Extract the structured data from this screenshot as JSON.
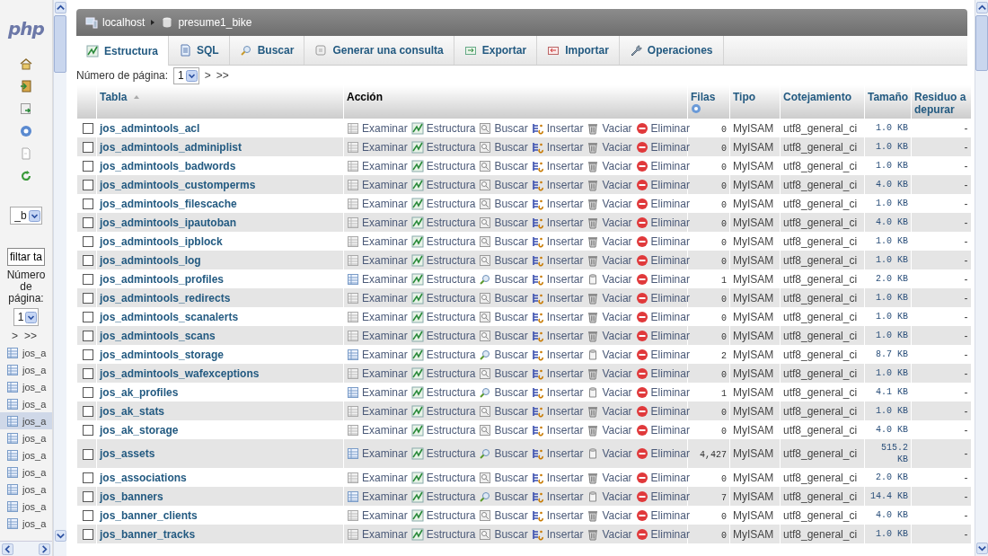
{
  "sidebar": {
    "logo": "php",
    "database_select": "_b",
    "filter": "filtar ta",
    "page_label": "Número de página:",
    "page_select": "1",
    "pager": [
      ">",
      ">>"
    ],
    "items": [
      {
        "label": "jos_a",
        "selected": false
      },
      {
        "label": "jos_a",
        "selected": false
      },
      {
        "label": "jos_a",
        "selected": false
      },
      {
        "label": "jos_a",
        "selected": false
      },
      {
        "label": "jos_a",
        "selected": true
      },
      {
        "label": "jos_a",
        "selected": false
      },
      {
        "label": "jos_a",
        "selected": false
      },
      {
        "label": "jos_a",
        "selected": false
      },
      {
        "label": "jos_a",
        "selected": false
      },
      {
        "label": "jos_a",
        "selected": false
      },
      {
        "label": "jos_a",
        "selected": false
      }
    ]
  },
  "breadcrumb": [
    {
      "kind": "server",
      "label": "localhost"
    },
    {
      "kind": "database",
      "label": "presume1_bike"
    }
  ],
  "tabs": [
    {
      "kind": "structure",
      "label": "Estructura",
      "selected": true
    },
    {
      "kind": "sql",
      "label": "SQL",
      "selected": false
    },
    {
      "kind": "search",
      "label": "Buscar",
      "selected": false
    },
    {
      "kind": "query",
      "label": "Generar una consulta",
      "selected": false
    },
    {
      "kind": "export",
      "label": "Exportar",
      "selected": false
    },
    {
      "kind": "import",
      "label": "Importar",
      "selected": false
    },
    {
      "kind": "operations",
      "label": "Operaciones",
      "selected": false
    }
  ],
  "pagination": {
    "label": "Número de página:",
    "value": "1",
    "next": ">",
    "last": ">>"
  },
  "table": {
    "columns": [
      "Tabla",
      "Acción",
      "Filas",
      "Tipo",
      "Cotejamiento",
      "Tamaño",
      "Residuo a depurar"
    ],
    "rows": [
      {
        "name": "jos_admintools_acl",
        "checked": false,
        "empty": true,
        "actions": [
          "Examinar",
          "Estructura",
          "Buscar",
          "Insertar",
          "Vaciar",
          "Eliminar"
        ],
        "rows": "0",
        "type": "MyISAM",
        "collation": "utf8_general_ci",
        "size": "1.0 KB",
        "overhead": "-"
      },
      {
        "name": "jos_admintools_adminiplist",
        "checked": false,
        "empty": true,
        "actions": [
          "Examinar",
          "Estructura",
          "Buscar",
          "Insertar",
          "Vaciar",
          "Eliminar"
        ],
        "rows": "0",
        "type": "MyISAM",
        "collation": "utf8_general_ci",
        "size": "1.0 KB",
        "overhead": "-"
      },
      {
        "name": "jos_admintools_badwords",
        "checked": false,
        "empty": true,
        "actions": [
          "Examinar",
          "Estructura",
          "Buscar",
          "Insertar",
          "Vaciar",
          "Eliminar"
        ],
        "rows": "0",
        "type": "MyISAM",
        "collation": "utf8_general_ci",
        "size": "1.0 KB",
        "overhead": "-"
      },
      {
        "name": "jos_admintools_customperms",
        "checked": false,
        "empty": true,
        "actions": [
          "Examinar",
          "Estructura",
          "Buscar",
          "Insertar",
          "Vaciar",
          "Eliminar"
        ],
        "rows": "0",
        "type": "MyISAM",
        "collation": "utf8_general_ci",
        "size": "4.0 KB",
        "overhead": "-"
      },
      {
        "name": "jos_admintools_filescache",
        "checked": false,
        "empty": true,
        "actions": [
          "Examinar",
          "Estructura",
          "Buscar",
          "Insertar",
          "Vaciar",
          "Eliminar"
        ],
        "rows": "0",
        "type": "MyISAM",
        "collation": "utf8_general_ci",
        "size": "1.0 KB",
        "overhead": "-"
      },
      {
        "name": "jos_admintools_ipautoban",
        "checked": false,
        "empty": true,
        "actions": [
          "Examinar",
          "Estructura",
          "Buscar",
          "Insertar",
          "Vaciar",
          "Eliminar"
        ],
        "rows": "0",
        "type": "MyISAM",
        "collation": "utf8_general_ci",
        "size": "4.0 KB",
        "overhead": "-"
      },
      {
        "name": "jos_admintools_ipblock",
        "checked": false,
        "empty": true,
        "actions": [
          "Examinar",
          "Estructura",
          "Buscar",
          "Insertar",
          "Vaciar",
          "Eliminar"
        ],
        "rows": "0",
        "type": "MyISAM",
        "collation": "utf8_general_ci",
        "size": "1.0 KB",
        "overhead": "-"
      },
      {
        "name": "jos_admintools_log",
        "checked": false,
        "empty": true,
        "actions": [
          "Examinar",
          "Estructura",
          "Buscar",
          "Insertar",
          "Vaciar",
          "Eliminar"
        ],
        "rows": "0",
        "type": "MyISAM",
        "collation": "utf8_general_ci",
        "size": "1.0 KB",
        "overhead": "-"
      },
      {
        "name": "jos_admintools_profiles",
        "checked": false,
        "empty": false,
        "actions": [
          "Examinar",
          "Estructura",
          "Buscar",
          "Insertar",
          "Vaciar",
          "Eliminar"
        ],
        "rows": "1",
        "type": "MyISAM",
        "collation": "utf8_general_ci",
        "size": "2.0 KB",
        "overhead": "-"
      },
      {
        "name": "jos_admintools_redirects",
        "checked": false,
        "empty": true,
        "actions": [
          "Examinar",
          "Estructura",
          "Buscar",
          "Insertar",
          "Vaciar",
          "Eliminar"
        ],
        "rows": "0",
        "type": "MyISAM",
        "collation": "utf8_general_ci",
        "size": "1.0 KB",
        "overhead": "-"
      },
      {
        "name": "jos_admintools_scanalerts",
        "checked": false,
        "empty": true,
        "actions": [
          "Examinar",
          "Estructura",
          "Buscar",
          "Insertar",
          "Vaciar",
          "Eliminar"
        ],
        "rows": "0",
        "type": "MyISAM",
        "collation": "utf8_general_ci",
        "size": "1.0 KB",
        "overhead": "-"
      },
      {
        "name": "jos_admintools_scans",
        "checked": false,
        "empty": true,
        "actions": [
          "Examinar",
          "Estructura",
          "Buscar",
          "Insertar",
          "Vaciar",
          "Eliminar"
        ],
        "rows": "0",
        "type": "MyISAM",
        "collation": "utf8_general_ci",
        "size": "1.0 KB",
        "overhead": "-"
      },
      {
        "name": "jos_admintools_storage",
        "checked": false,
        "empty": false,
        "actions": [
          "Examinar",
          "Estructura",
          "Buscar",
          "Insertar",
          "Vaciar",
          "Eliminar"
        ],
        "rows": "2",
        "type": "MyISAM",
        "collation": "utf8_general_ci",
        "size": "8.7 KB",
        "overhead": "-"
      },
      {
        "name": "jos_admintools_wafexceptions",
        "checked": false,
        "empty": true,
        "actions": [
          "Examinar",
          "Estructura",
          "Buscar",
          "Insertar",
          "Vaciar",
          "Eliminar"
        ],
        "rows": "0",
        "type": "MyISAM",
        "collation": "utf8_general_ci",
        "size": "1.0 KB",
        "overhead": "-"
      },
      {
        "name": "jos_ak_profiles",
        "checked": false,
        "empty": false,
        "actions": [
          "Examinar",
          "Estructura",
          "Buscar",
          "Insertar",
          "Vaciar",
          "Eliminar"
        ],
        "rows": "1",
        "type": "MyISAM",
        "collation": "utf8_general_ci",
        "size": "4.1 KB",
        "overhead": "-"
      },
      {
        "name": "jos_ak_stats",
        "checked": false,
        "empty": true,
        "actions": [
          "Examinar",
          "Estructura",
          "Buscar",
          "Insertar",
          "Vaciar",
          "Eliminar"
        ],
        "rows": "0",
        "type": "MyISAM",
        "collation": "utf8_general_ci",
        "size": "1.0 KB",
        "overhead": "-"
      },
      {
        "name": "jos_ak_storage",
        "checked": false,
        "empty": true,
        "actions": [
          "Examinar",
          "Estructura",
          "Buscar",
          "Insertar",
          "Vaciar",
          "Eliminar"
        ],
        "rows": "0",
        "type": "MyISAM",
        "collation": "utf8_general_ci",
        "size": "4.0 KB",
        "overhead": "-"
      },
      {
        "name": "jos_assets",
        "checked": false,
        "empty": false,
        "actions": [
          "Examinar",
          "Estructura",
          "Buscar",
          "Insertar",
          "Vaciar",
          "Eliminar"
        ],
        "rows": "4,427",
        "type": "MyISAM",
        "collation": "utf8_general_ci",
        "size": "515.2 KB",
        "overhead": "-"
      },
      {
        "name": "jos_associations",
        "checked": false,
        "empty": true,
        "actions": [
          "Examinar",
          "Estructura",
          "Buscar",
          "Insertar",
          "Vaciar",
          "Eliminar"
        ],
        "rows": "0",
        "type": "MyISAM",
        "collation": "utf8_general_ci",
        "size": "2.0 KB",
        "overhead": "-"
      },
      {
        "name": "jos_banners",
        "checked": false,
        "empty": false,
        "actions": [
          "Examinar",
          "Estructura",
          "Buscar",
          "Insertar",
          "Vaciar",
          "Eliminar"
        ],
        "rows": "7",
        "type": "MyISAM",
        "collation": "utf8_general_ci",
        "size": "14.4 KB",
        "overhead": "-"
      },
      {
        "name": "jos_banner_clients",
        "checked": false,
        "empty": true,
        "actions": [
          "Examinar",
          "Estructura",
          "Buscar",
          "Insertar",
          "Vaciar",
          "Eliminar"
        ],
        "rows": "0",
        "type": "MyISAM",
        "collation": "utf8_general_ci",
        "size": "4.0 KB",
        "overhead": "-"
      },
      {
        "name": "jos_banner_tracks",
        "checked": false,
        "empty": true,
        "actions": [
          "Examinar",
          "Estructura",
          "Buscar",
          "Insertar",
          "Vaciar",
          "Eliminar"
        ],
        "rows": "0",
        "type": "MyISAM",
        "collation": "utf8_general_ci",
        "size": "1.0 KB",
        "overhead": "-"
      }
    ]
  }
}
